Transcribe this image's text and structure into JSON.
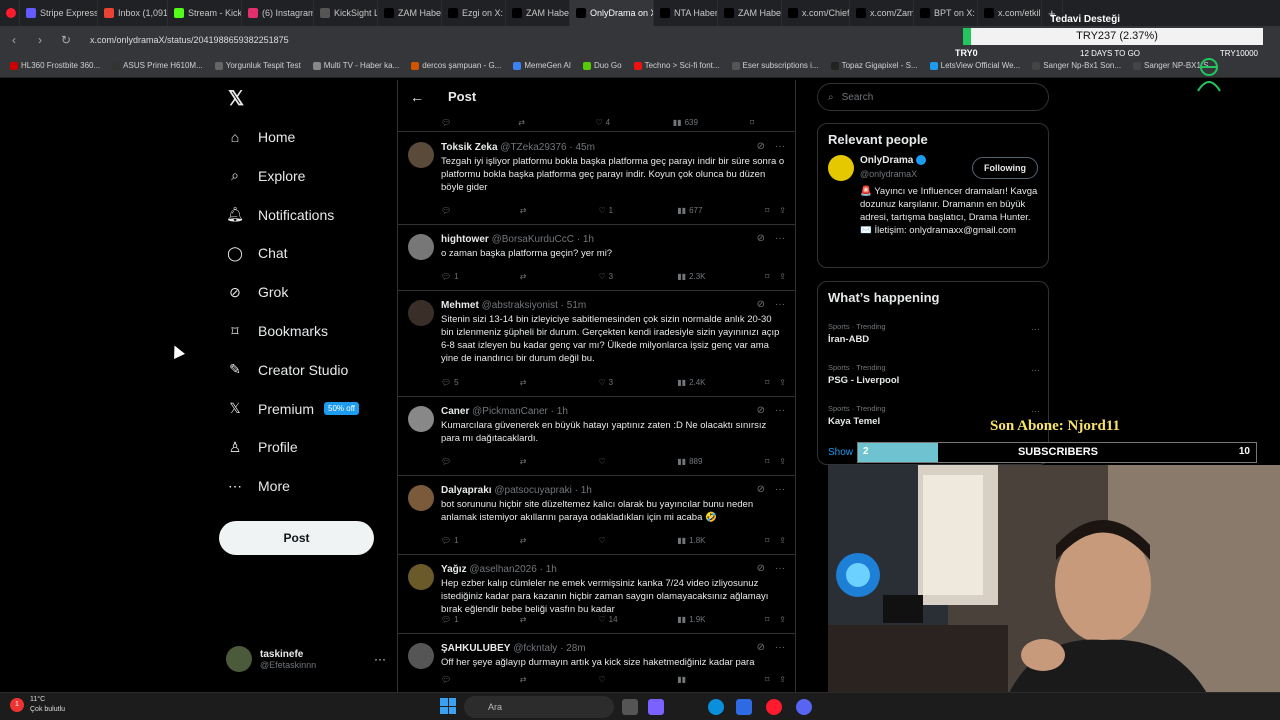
{
  "browser": {
    "tabs": [
      {
        "label": "Stripe Express",
        "color": "#635bff"
      },
      {
        "label": "Inbox (1,091)",
        "color": "#ea4335"
      },
      {
        "label": "Stream - Kick",
        "color": "#53fc18"
      },
      {
        "label": "(6) Instagram",
        "color": "#e1306c"
      },
      {
        "label": "KickSight Link",
        "color": "#555"
      },
      {
        "label": "ZAM Haber o",
        "color": "#000"
      },
      {
        "label": "Ezgi on X: \"th",
        "color": "#000"
      },
      {
        "label": "ZAM Haber o",
        "color": "#000"
      },
      {
        "label": "OnlyDrama on X: \"Hype",
        "color": "#000",
        "active": true
      },
      {
        "label": "NTA Haber o",
        "color": "#000"
      },
      {
        "label": "ZAM Haber o",
        "color": "#000"
      },
      {
        "label": "x.com/Chiefta",
        "color": "#000"
      },
      {
        "label": "x.com/ZamHa",
        "color": "#000"
      },
      {
        "label": "BPT on X: \"Fle",
        "color": "#000"
      },
      {
        "label": "x.com/etkilih",
        "color": "#000"
      }
    ],
    "url": "x.com/onlydramaX/status/2041988659382251875",
    "bookmarks": [
      "HL360 Frostbite 360...",
      "ASUS Prime H610M...",
      "Yorgunluk Tespit Test",
      "Multi TV - Haber ka...",
      "dercos şampuan - G...",
      "MemeGen AI",
      "Duo Go",
      "Techno > Sci-fi font...",
      "Eser subscriptions i...",
      "Topaz Gigapixel - S...",
      "LetsView Official We...",
      "Sanger Np-Bx1 Son...",
      "Sanger NP-BX1 S"
    ]
  },
  "donation_goal": {
    "label": "Tedavi Desteği",
    "amount": "TRY237 (2.37%)",
    "progress_pct": 2.37,
    "left": "TRY0",
    "middle": "12 DAYS TO GO",
    "right": "TRY10000"
  },
  "nav": {
    "items": [
      "Home",
      "Explore",
      "Notifications",
      "Chat",
      "Grok",
      "Bookmarks",
      "Creator Studio",
      "Premium",
      "Profile",
      "More"
    ],
    "premium_badge": "50% off",
    "post_button": "Post",
    "account_name": "taskinefe",
    "account_handle": "@Efetaskinnn"
  },
  "column": {
    "title": "Post",
    "prev_stats": {
      "likes": "4",
      "views": "639"
    },
    "tweets": [
      {
        "name": "Toksik Zeka",
        "handle": "@TZeka29376",
        "time": "45m",
        "text": "Tezgah iyi işliyor platformu bokla başka platforma geç parayı indir bir süre sonra o platformu bokla başka platforma geç parayı indir. Koyun çok olunca bu düzen böyle gider",
        "replies": "",
        "reposts": "",
        "likes": "1",
        "views": "677"
      },
      {
        "name": "hightower",
        "handle": "@BorsaKurduCcC",
        "time": "1h",
        "text": "o zaman başka platforma geçin? yer mi?",
        "replies": "1",
        "reposts": "",
        "likes": "3",
        "views": "2.3K"
      },
      {
        "name": "Mehmet",
        "handle": "@abstraksiyonist",
        "time": "51m",
        "text": "Sitenin sizi 13-14 bin izleyiciye sabitlemesinden çok sizin normalde anlık 20-30 bin izlenmeniz şüpheli bir durum. Gerçekten kendi iradesiyle sizin yayınınızı açıp 6-8 saat izleyen bu kadar genç var mı? Ülkede milyonlarca işsiz genç var ama yine de inandırıcı bir durum değil bu.",
        "replies": "5",
        "reposts": "",
        "likes": "3",
        "views": "2.4K"
      },
      {
        "name": "Caner",
        "handle": "@PickmanCaner",
        "time": "1h",
        "text": "Kumarcılara güvenerek en büyük hatayı yaptınız zaten :D Ne olacaktı sınırsız para mı dağıtacaklardı.",
        "replies": "",
        "reposts": "",
        "likes": "",
        "views": "889"
      },
      {
        "name": "Dalyaprakı",
        "handle": "@patsocuyapraki",
        "time": "1h",
        "text": "bot sorununu hiçbir site düzeltemez kalıcı olarak bu yayıncılar bunu neden anlamak istemiyor akıllarını paraya odakladıkları için mi acaba 🤣",
        "replies": "1",
        "reposts": "",
        "likes": "",
        "views": "1.8K"
      },
      {
        "name": "Yağız",
        "handle": "@aselhan2026",
        "time": "1h",
        "text": "Hep ezber kalıp cümleler ne emek vermişsiniz kanka 7/24 video izliyosunuz istediğiniz kadar para kazanın hiçbir zaman saygın olamayacaksınız ağlamayı bırak eğlendir bebe beliği vasfın bu kadar",
        "replies": "1",
        "reposts": "",
        "likes": "14",
        "views": "1.9K"
      },
      {
        "name": "ŞAHKULUBEY",
        "handle": "@fckntaly",
        "time": "28m",
        "text": "Off her şeye ağlayıp durmayın artık ya kick size haketmediğiniz kadar para",
        "replies": "",
        "reposts": "",
        "likes": "",
        "views": ""
      }
    ]
  },
  "right": {
    "search_placeholder": "Search",
    "relevant_title": "Relevant people",
    "rp_name": "OnlyDrama",
    "rp_handle": "@onlydramaX",
    "rp_follow": "Following",
    "rp_bio": "🚨 Yayıncı ve Influencer dramaları! Kavga dozunuz karşılanır. Dramanın en büyük adresi, tartışma başlatıcı, Drama Hunter. ✉️ İletişim: onlydramaxx@gmail.com",
    "happening_title": "What’s happening",
    "trends": [
      {
        "cat": "Sports · Trending",
        "name": "İran-ABD"
      },
      {
        "cat": "Sports · Trending",
        "name": "PSG - Liverpool"
      },
      {
        "cat": "Sports · Trending",
        "name": "Kaya Temel"
      }
    ],
    "show_more": "Show"
  },
  "overlay": {
    "son_abone": "Son Abone: Njord11",
    "sub_current": "2",
    "sub_label": "SUBSCRIBERS",
    "sub_goal": "10",
    "sub_fraction": 0.2
  },
  "taskbar": {
    "temp": "11°C",
    "weather": "Çok bulutlu",
    "search": "Ara",
    "notif": "1"
  }
}
